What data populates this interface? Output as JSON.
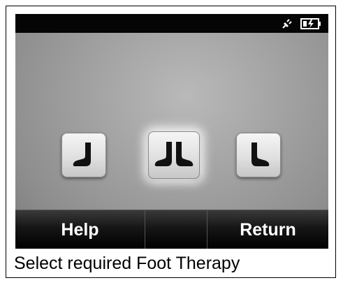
{
  "statusbar": {
    "plug_icon": "power-plug-icon",
    "battery_icon": "battery-charging-icon"
  },
  "foot_buttons": [
    {
      "icon": "left-foot-icon",
      "selected": false
    },
    {
      "icon": "both-feet-icon",
      "selected": true
    },
    {
      "icon": "right-foot-icon",
      "selected": false
    }
  ],
  "softkeys": {
    "help_label": "Help",
    "middle_label": "",
    "return_label": "Return"
  },
  "caption": "Select required Foot Therapy",
  "colors": {
    "statusbar": "#050505",
    "foot_icon": "#111111",
    "softkey_text": "#ffffff"
  }
}
